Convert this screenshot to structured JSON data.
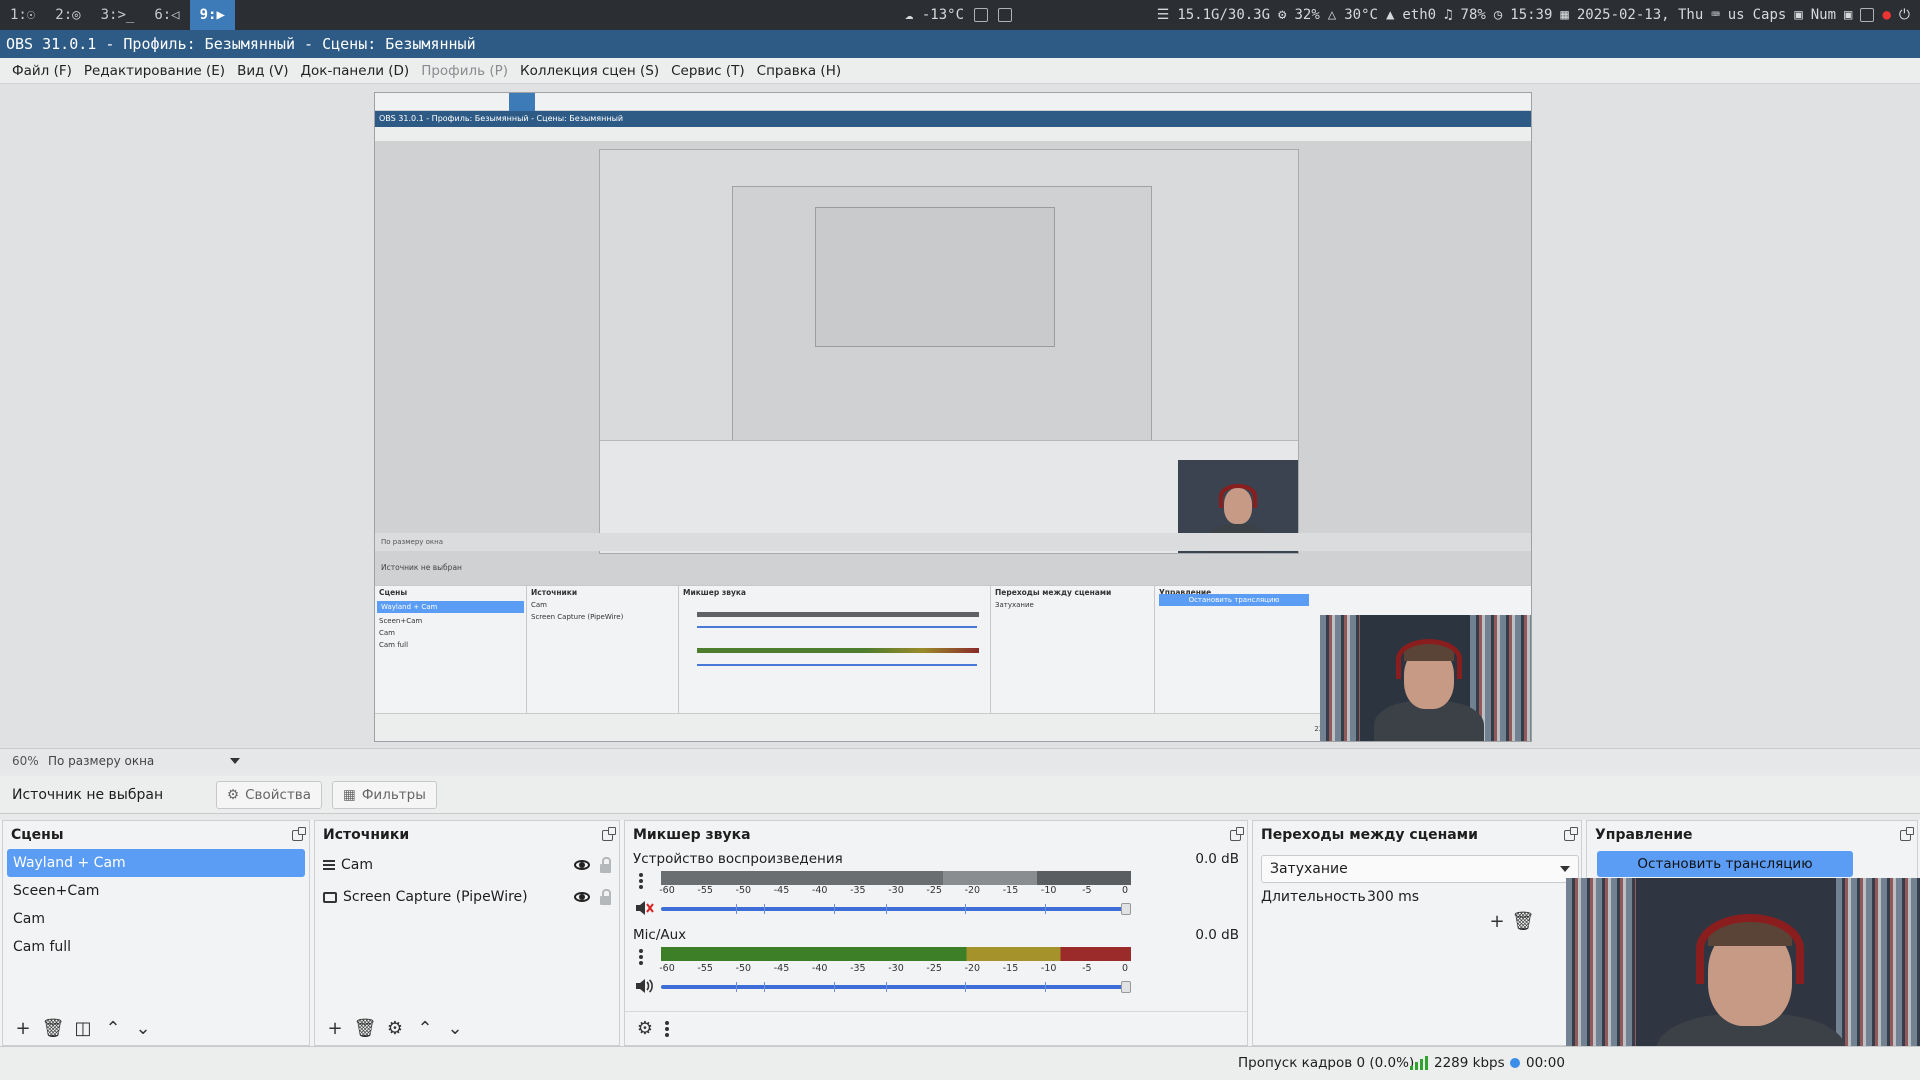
{
  "sysbar": {
    "workspaces": [
      "1:☉",
      "2:◎",
      "3:>_",
      "6:◁",
      "9:▶"
    ],
    "weather": "☁ -13°C",
    "memory": "15.1G/30.3G",
    "cpu": "32%",
    "temp": "30°C",
    "net": "eth0",
    "volume": "78%",
    "time": "15:39",
    "date": "2025-02-13, Thu",
    "layout": "us",
    "caps": "Caps",
    "num": "Num"
  },
  "window": {
    "title": "OBS 31.0.1 - Профиль: Безымянный - Сцены: Безымянный"
  },
  "menu": {
    "items": [
      {
        "label": "Файл (F)"
      },
      {
        "label": "Редактирование (E)"
      },
      {
        "label": "Вид (V)"
      },
      {
        "label": "Док-панели (D)"
      },
      {
        "label": "Профиль (P)"
      },
      {
        "label": "Коллекция сцен (S)"
      },
      {
        "label": "Сервис (T)"
      },
      {
        "label": "Справка (H)"
      }
    ]
  },
  "zoom": {
    "value": "60%",
    "mode": "По размеру окна"
  },
  "source_bar": {
    "status": "Источник не выбран",
    "properties": "Свойства",
    "filters": "Фильтры"
  },
  "scenes": {
    "title": "Сцены",
    "items": [
      "Wayland + Cam",
      "Sceen+Cam",
      "Cam",
      "Cam full"
    ],
    "selected": 0
  },
  "sources": {
    "title": "Источники",
    "items": [
      {
        "name": "Cam",
        "icon": "list-icon"
      },
      {
        "name": "Screen Capture (PipeWire)",
        "icon": "monitor-icon"
      }
    ]
  },
  "mixer": {
    "title": "Микшер звука",
    "ticks": [
      "-60",
      "-55",
      "-50",
      "-45",
      "-40",
      "-35",
      "-30",
      "-25",
      "-20",
      "-15",
      "-10",
      "-5",
      "0"
    ],
    "channels": [
      {
        "name": "Устройство воспроизведения",
        "db": "0.0 dB",
        "muted": true
      },
      {
        "name": "Mic/Aux",
        "db": "0.0 dB",
        "muted": false
      }
    ]
  },
  "transitions": {
    "title": "Переходы между сценами",
    "type": "Затухание",
    "duration_label": "Длительность",
    "duration_value": "300 ms"
  },
  "controls": {
    "title": "Управление",
    "stop_stream": "Остановить трансляцию"
  },
  "status": {
    "dropped": "Пропуск кадров 0 (0.0%)",
    "bitrate": "2289 kbps",
    "time": "00:00"
  },
  "colors": {
    "accent": "#5b9df5",
    "title_bar": "#2d5b86",
    "active_workspace": "#3c7ab8"
  }
}
